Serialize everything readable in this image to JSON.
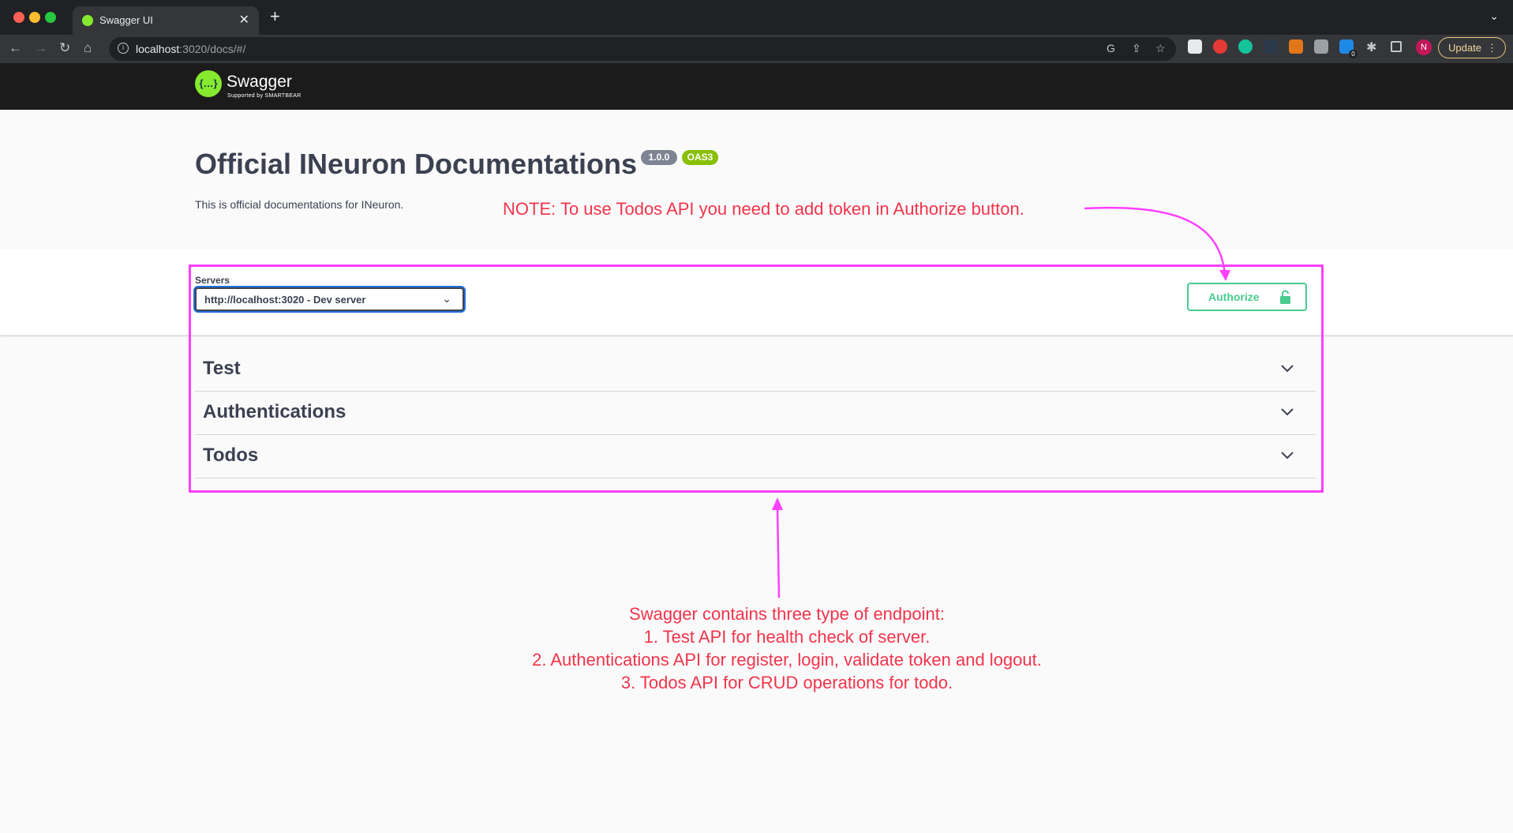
{
  "browser": {
    "tab_title": "Swagger UI",
    "new_tab_icon": "plus-icon",
    "url_host": "localhost",
    "url_path": ":3020/docs/#/",
    "update_label": "Update",
    "profile_initial": "N",
    "extension_badge": "0"
  },
  "swagger": {
    "logo_text": "Swagger",
    "logo_mark": "{…}",
    "logo_sub": "Supported by SMARTBEAR"
  },
  "info": {
    "title": "Official INeuron Documentations",
    "version": "1.0.0",
    "oas": "OAS3",
    "description": "This is official documentations for INeuron."
  },
  "servers": {
    "label": "Servers",
    "selected": "http://localhost:3020 - Dev server"
  },
  "authorize": {
    "label": "Authorize"
  },
  "tags": [
    {
      "name": "Test"
    },
    {
      "name": "Authentications"
    },
    {
      "name": "Todos"
    }
  ],
  "annotations": {
    "note": "NOTE: To use Todos API you need to add token in Authorize button.",
    "summary_lines": [
      "Swagger contains three type of endpoint:",
      "1. Test API for health check of server.",
      "2. Authentications API for register, login, validate token and logout.",
      "3. Todos API for CRUD operations for todo."
    ]
  },
  "colors": {
    "accent_green": "#49cc90",
    "swagger_green": "#85ea2d",
    "annotation_red": "#f2344b",
    "annotation_magenta": "#ff40ff",
    "topbar": "#1b1b1b"
  }
}
